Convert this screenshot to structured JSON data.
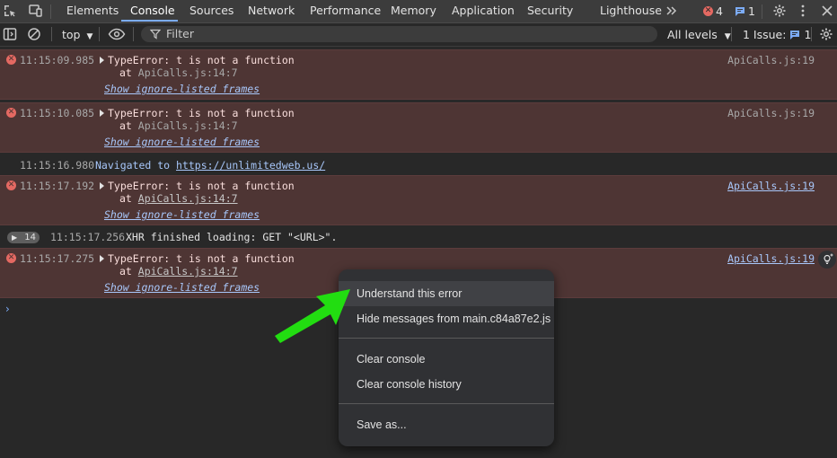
{
  "tabs": [
    "Elements",
    "Console",
    "Sources",
    "Network",
    "Performance",
    "Memory",
    "Application",
    "Security",
    "Lighthouse"
  ],
  "active_tab": "Console",
  "more_tabs_icon": "chevrons-right-icon",
  "badges": {
    "errors": "4",
    "messages": "1"
  },
  "toolbar": {
    "context": "top",
    "filter_placeholder": "Filter",
    "levels": "All levels",
    "issues_label": "1 Issue:",
    "issues_count": "1"
  },
  "messages": [
    {
      "type": "error",
      "time": "11:15:09.985",
      "text": "TypeError: t is not a function",
      "at_prefix": "at ",
      "at_loc": "ApiCalls.js:14:7",
      "ignore": "Show ignore-listed frames",
      "source": "ApiCalls.js:19"
    },
    {
      "type": "error",
      "time": "11:15:10.085",
      "text": "TypeError: t is not a function",
      "at_prefix": "at ",
      "at_loc": "ApiCalls.js:14:7",
      "ignore": "Show ignore-listed frames",
      "source": "ApiCalls.js:19"
    },
    {
      "type": "nav",
      "time": "11:15:16.980",
      "text": "Navigated to ",
      "url": "https://unlimitedweb.us/"
    },
    {
      "type": "error",
      "time": "11:15:17.192",
      "text": "TypeError: t is not a function",
      "at_prefix": "at ",
      "at_loc": "ApiCalls.js:14:7",
      "ignore": "Show ignore-listed frames",
      "source": "ApiCalls.js:19"
    },
    {
      "type": "info",
      "count": "14",
      "time": "11:15:17.256",
      "text": "XHR finished loading: GET \"<URL>\"."
    },
    {
      "type": "error",
      "time": "11:15:17.275",
      "text": "TypeError: t is not a function",
      "at_prefix": "at ",
      "at_loc": "ApiCalls.js:14:7",
      "ignore": "Show ignore-listed frames",
      "source": "ApiCalls.js:19"
    }
  ],
  "prompt": "›",
  "context_menu": {
    "items": [
      "Understand this error",
      "Hide messages from main.c84a87e2.js",
      "Clear console",
      "Clear console history",
      "Save as..."
    ]
  },
  "colors": {
    "error_bg": "#4e3534",
    "link": "#a8c7fa",
    "accent": "#7cacf8",
    "arrow": "#22dd11"
  }
}
